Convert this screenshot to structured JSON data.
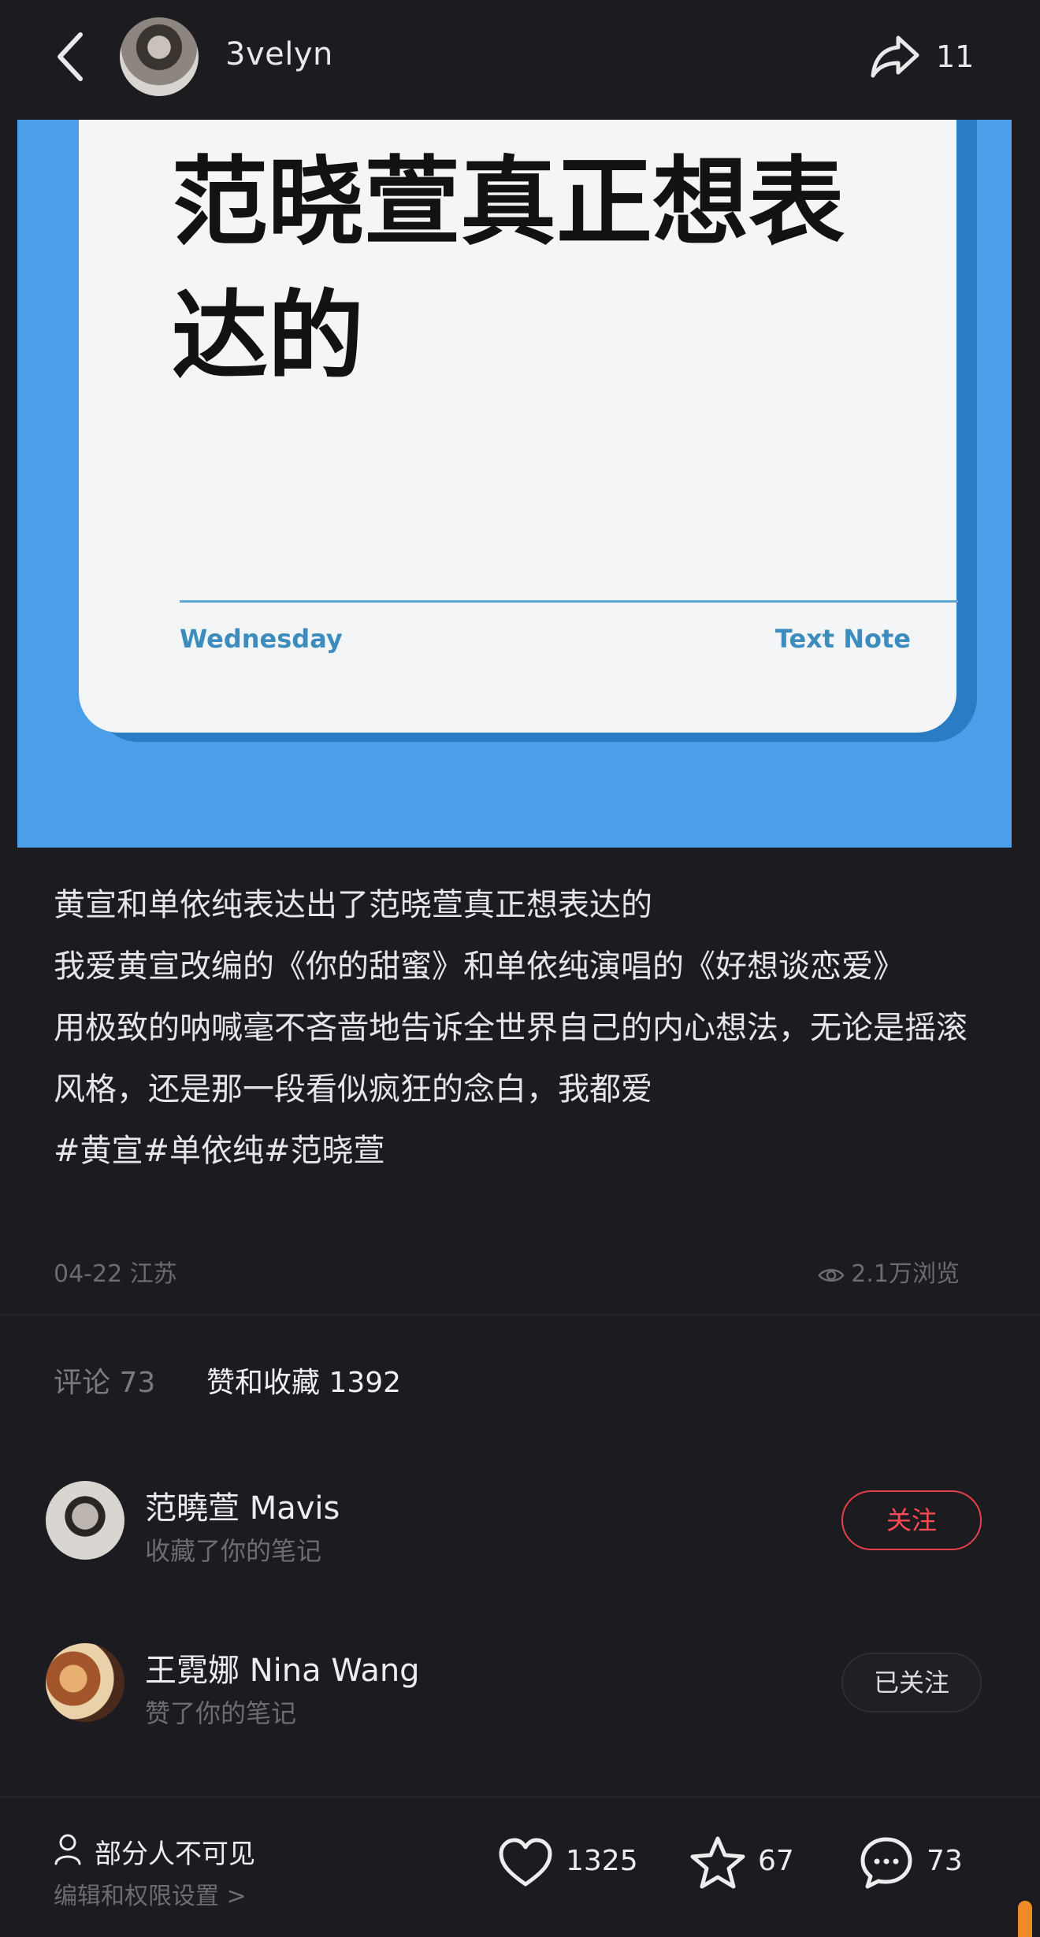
{
  "header": {
    "username": "3velyn",
    "share_count": "11"
  },
  "hero": {
    "title": "范晓萱真正想表达的",
    "footer_left": "Wednesday",
    "footer_right": "Text Note"
  },
  "post": {
    "line1": "黄宣和单依纯表达出了范晓萱真正想表达的",
    "line2": "我爱黄宣改编的《你的甜蜜》和单依纯演唱的《好想谈恋爱》",
    "line3": "用极致的呐喊毫不吝啬地告诉全世界自己的内心想法，无论是摇滚风格，还是那一段看似疯狂的念白，我都爱",
    "hashtags": "#黄宣#单依纯#范晓萱",
    "date_location": "04-22 江苏",
    "views": "2.1万浏览"
  },
  "tabs": {
    "comments": "评论 73",
    "likes_collects": "赞和收藏 1392"
  },
  "activity": [
    {
      "name": "范曉萱 Mavis",
      "action": "收藏了你的笔记",
      "button": "关注"
    },
    {
      "name": "王霓娜 Nina Wang",
      "action": "赞了你的笔记",
      "button": "已关注"
    }
  ],
  "bottom": {
    "privacy": "部分人不可见",
    "settings": "编辑和权限设置 >",
    "likes": "1325",
    "stars": "67",
    "comments": "73"
  },
  "colors": {
    "background": "#1b1b20",
    "hero_blue": "#4a9fe8",
    "follow_red": "#ff4b55",
    "note_accent": "#3c8dbd"
  },
  "icons": [
    "back-icon",
    "share-icon",
    "eye-icon",
    "person-icon",
    "heart-icon",
    "star-icon",
    "comment-icon"
  ]
}
